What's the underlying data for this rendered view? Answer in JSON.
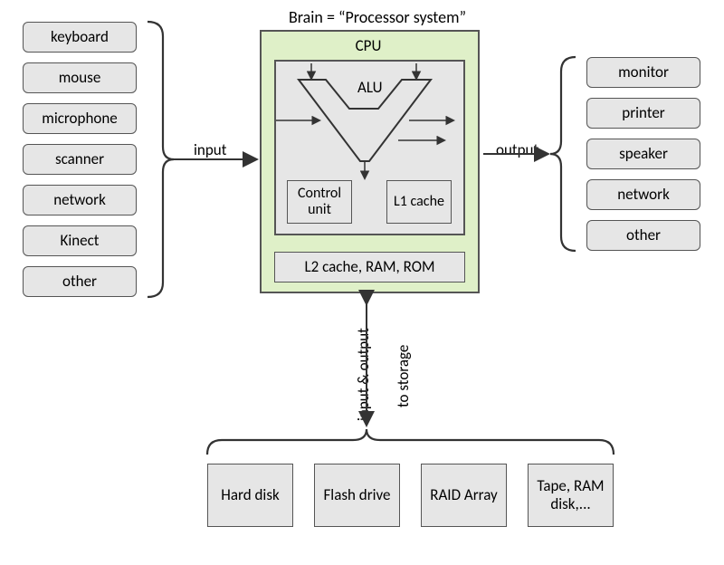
{
  "title": "Brain = “Processor system”",
  "input_devices": [
    "keyboard",
    "mouse",
    "microphone",
    "scanner",
    "network",
    "Kinect",
    "other"
  ],
  "output_devices": [
    "monitor",
    "printer",
    "speaker",
    "network",
    "other"
  ],
  "storage_devices": [
    "Hard disk",
    "Flash drive",
    "RAID Array",
    "Tape, RAM disk,..."
  ],
  "cpu": {
    "label": "CPU",
    "alu": "ALU",
    "control_unit": "Control unit",
    "l1_cache": "L1 cache",
    "memory": "L2 cache, RAM, ROM"
  },
  "arrows": {
    "input": "input",
    "output": "output",
    "storage": "input & output",
    "storage_to": "to storage"
  }
}
